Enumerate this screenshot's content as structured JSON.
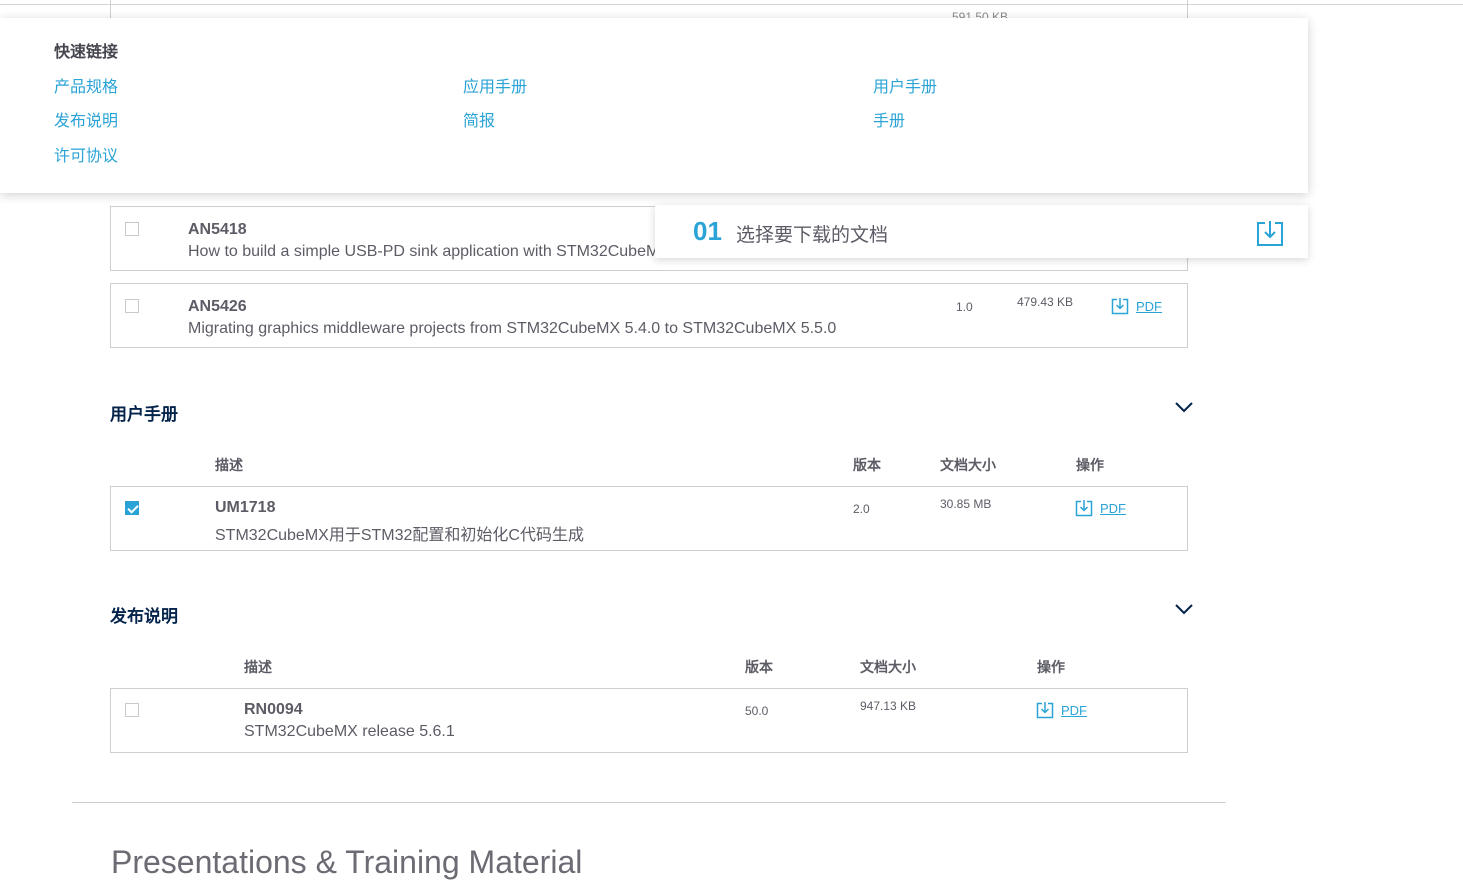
{
  "background_peek": "591.50 KB",
  "quick_links": {
    "title": "快速链接",
    "links": [
      "产品规格",
      "应用手册",
      "用户手册",
      "发布说明",
      "简报",
      "手册",
      "许可协议"
    ]
  },
  "step": {
    "number": "01",
    "text": "选择要下载的文档",
    "icon": "download-icon"
  },
  "app_notes": {
    "rows": [
      {
        "code": "AN5418",
        "desc": "How to build a simple USB-PD sink application with STM32CubeMX"
      },
      {
        "code": "AN5426",
        "desc": "Migrating graphics middleware projects from STM32CubeMX 5.4.0 to STM32CubeMX 5.5.0",
        "version": "1.0",
        "size": "479.43 KB",
        "action": "PDF"
      }
    ]
  },
  "user_manuals": {
    "title": "用户手册",
    "headers": {
      "desc": "描述",
      "version": "版本",
      "size": "文档大小",
      "action": "操作"
    },
    "rows": [
      {
        "checked": true,
        "code": "UM1718",
        "desc": "STM32CubeMX用于STM32配置和初始化C代码生成",
        "version": "2.0",
        "size": "30.85 MB",
        "action": "PDF"
      }
    ]
  },
  "release_notes": {
    "title": "发布说明",
    "headers": {
      "desc": "描述",
      "version": "版本",
      "size": "文档大小",
      "action": "操作"
    },
    "rows": [
      {
        "checked": false,
        "code": "RN0094",
        "desc": "STM32CubeMX release 5.6.1",
        "version": "50.0",
        "size": "947.13 KB",
        "action": "PDF"
      }
    ]
  },
  "presentations": {
    "title": "Presentations & Training Material"
  },
  "colors": {
    "accent": "#2aa3d6",
    "heading": "#03234b",
    "text": "#5c5c66",
    "border": "#cfcfcf"
  }
}
